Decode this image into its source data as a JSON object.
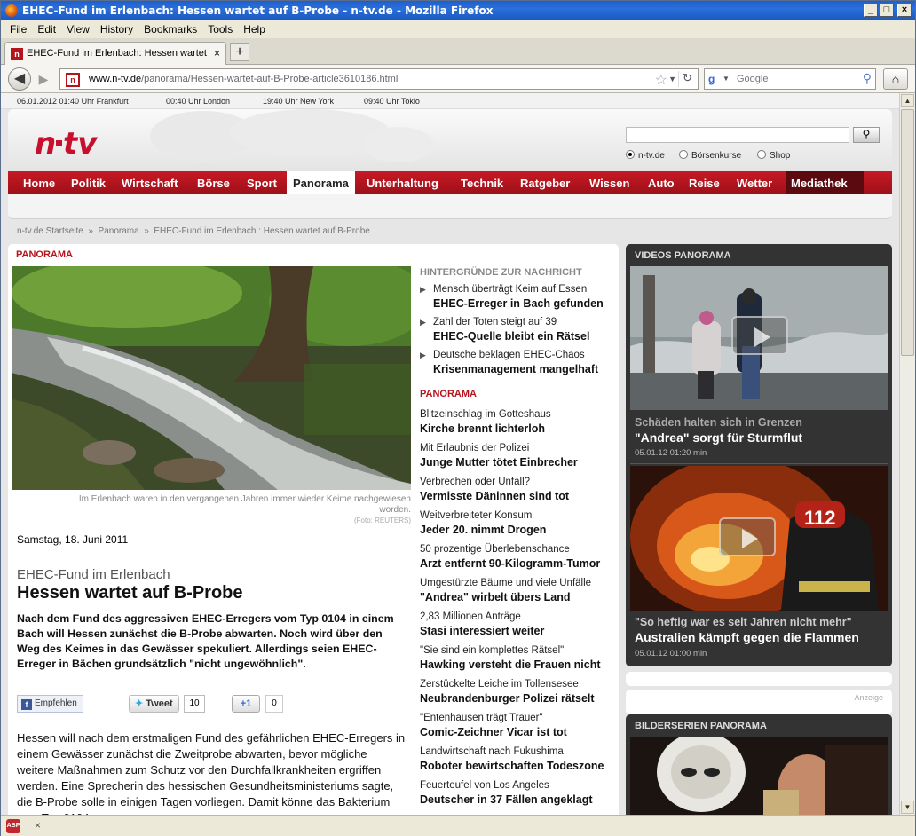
{
  "window": {
    "title": "EHEC-Fund im Erlenbach: Hessen wartet auf B-Probe - n-tv.de - Mozilla Firefox"
  },
  "menu": [
    "File",
    "Edit",
    "View",
    "History",
    "Bookmarks",
    "Tools",
    "Help"
  ],
  "tab": {
    "label": "EHEC-Fund im Erlenbach: Hessen wartet auf ...",
    "favicon": "n"
  },
  "nav": {
    "url_domain": "www.n-tv.de",
    "url_path": "/panorama/Hessen-wartet-auf-B-Probe-article3610186.html",
    "search_placeholder": "Google"
  },
  "times": [
    "06.01.2012 01:40 Uhr Frankfurt",
    "00:40 Uhr London",
    "19:40 Uhr New York",
    "09:40 Uhr Tokio"
  ],
  "site": {
    "logo": "n·tv",
    "search_options": [
      "n-tv.de",
      "Börsenkurse",
      "Shop"
    ],
    "nav_items": [
      "Home",
      "Politik",
      "Wirtschaft",
      "Börse",
      "Sport",
      "Panorama",
      "Unterhaltung",
      "Technik",
      "Ratgeber",
      "Wissen",
      "Auto",
      "Reise",
      "Wetter",
      "Mediathek"
    ],
    "active_nav": "Panorama"
  },
  "breadcrumb": [
    "n-tv.de Startseite",
    "Panorama",
    "EHEC-Fund im Erlenbach : Hessen wartet auf B-Probe"
  ],
  "article": {
    "section": "PANORAMA",
    "caption": "Im Erlenbach waren in den vergangenen Jahren immer wieder Keime nachgewiesen worden.",
    "photo_credit": "(Foto: REUTERS)",
    "date": "Samstag, 18. Juni 2011",
    "kicker": "EHEC-Fund im Erlenbach",
    "headline": "Hessen wartet auf B-Probe",
    "lead": "Nach dem Fund des aggressiven EHEC-Erregers vom Typ 0104 in einem Bach will Hessen zunächst die B-Probe abwarten. Noch wird über den Weg des Keimes in das Gewässer spekuliert. Allerdings seien EHEC-Erreger in Bächen grundsätzlich \"nicht ungewöhnlich\".",
    "social": {
      "fb": "Empfehlen",
      "tweet": "Tweet",
      "tweet_count": "10",
      "gplus": "+1",
      "gplus_count": "0"
    },
    "body": "Hessen will nach dem erstmaligen Fund des gefährlichen EHEC-Erregers in einem Gewässer zunächst die Zweitprobe abwarten, bevor mögliche weitere Maßnahmen zum Schutz vor den Durchfallkrankheiten ergriffen werden. Eine Sprecherin des hessischen Gesundheitsministeriums sagte, die B-Probe solle in einigen Tagen vorliegen. Damit könne das Bakterium vom Typ 0104"
  },
  "background": {
    "title": "HINTERGRÜNDE ZUR NACHRICHT",
    "items": [
      {
        "kicker": "Mensch überträgt Keim auf Essen",
        "title": "EHEC-Erreger in Bach gefunden"
      },
      {
        "kicker": "Zahl der Toten steigt auf 39",
        "title": "EHEC-Quelle bleibt ein Rätsel"
      },
      {
        "kicker": "Deutsche beklagen EHEC-Chaos",
        "title": "Krisenmanagement mangelhaft"
      }
    ]
  },
  "panorama_list": {
    "title": "PANORAMA",
    "items": [
      {
        "kicker": "Blitzeinschlag im Gotteshaus",
        "title": "Kirche brennt lichterloh"
      },
      {
        "kicker": "Mit Erlaubnis der Polizei",
        "title": "Junge Mutter tötet Einbrecher"
      },
      {
        "kicker": "Verbrechen oder Unfall?",
        "title": "Vermisste Däninnen sind tot"
      },
      {
        "kicker": "Weitverbreiteter Konsum",
        "title": "Jeder 20. nimmt Drogen"
      },
      {
        "kicker": "50 prozentige Überlebenschance",
        "title": "Arzt entfernt 90-Kilogramm-Tumor"
      },
      {
        "kicker": "Umgestürzte Bäume und viele Unfälle",
        "title": "\"Andrea\" wirbelt übers Land"
      },
      {
        "kicker": "2,83 Millionen Anträge",
        "title": "Stasi interessiert weiter"
      },
      {
        "kicker": "\"Sie sind ein komplettes Rätsel\"",
        "title": "Hawking versteht die Frauen nicht"
      },
      {
        "kicker": "Zerstückelte Leiche im Tollensesee",
        "title": "Neubrandenburger Polizei rätselt"
      },
      {
        "kicker": "\"Entenhausen trägt Trauer\"",
        "title": "Comic-Zeichner Vicar ist tot"
      },
      {
        "kicker": "Landwirtschaft nach Fukushima",
        "title": "Roboter bewirtschaften Todeszone"
      },
      {
        "kicker": "Feuerteufel von Los Angeles",
        "title": "Deutscher in 37 Fällen angeklagt"
      }
    ]
  },
  "videos": {
    "title": "VIDEOS PANORAMA",
    "items": [
      {
        "kicker": "Schäden halten sich in Grenzen",
        "title": "\"Andrea\" sorgt für Sturmflut",
        "meta": "05.01.12    01:20 min"
      },
      {
        "kicker": "\"So heftig war es seit Jahren nicht mehr\"",
        "title": "Australien kämpft gegen die Flammen",
        "meta": "05.01.12    01:00 min"
      }
    ]
  },
  "ad_label": "Anzeige",
  "bilderserien": {
    "title": "BILDERSERIEN PANORAMA"
  }
}
